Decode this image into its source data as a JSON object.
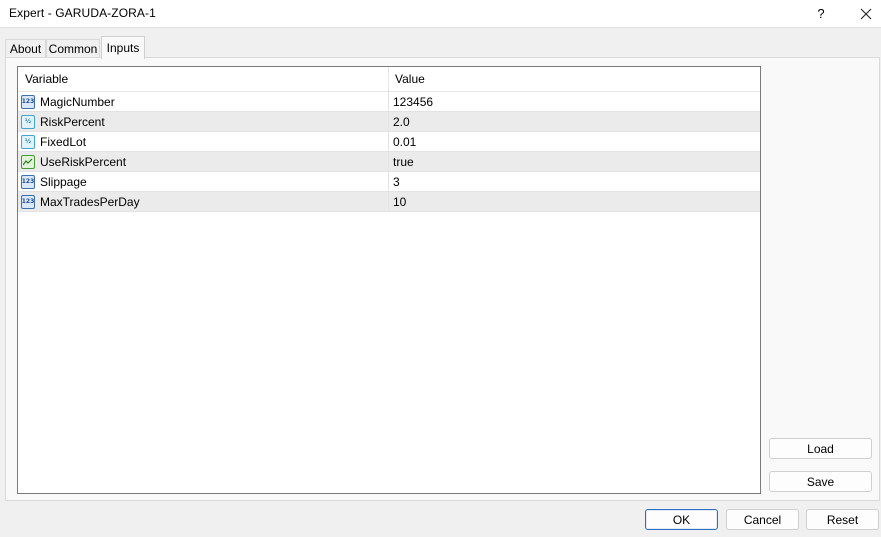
{
  "window": {
    "title": "Expert - GARUDA-ZORA-1",
    "help_label": "?"
  },
  "tabs": [
    {
      "label": "About",
      "active": false
    },
    {
      "label": "Common",
      "active": false
    },
    {
      "label": "Inputs",
      "active": true
    }
  ],
  "grid": {
    "columns": {
      "variable": "Variable",
      "value": "Value"
    },
    "rows": [
      {
        "icon": "integer-type-icon",
        "name": "MagicNumber",
        "value": "123456"
      },
      {
        "icon": "double-type-icon",
        "name": "RiskPercent",
        "value": "2.0"
      },
      {
        "icon": "double-type-icon",
        "name": "FixedLot",
        "value": "0.01"
      },
      {
        "icon": "boolean-type-icon",
        "name": "UseRiskPercent",
        "value": "true"
      },
      {
        "icon": "integer-type-icon",
        "name": "Slippage",
        "value": "3"
      },
      {
        "icon": "integer-type-icon",
        "name": "MaxTradesPerDay",
        "value": "10"
      }
    ]
  },
  "side_buttons": {
    "load": "Load",
    "save": "Save"
  },
  "footer": {
    "ok": "OK",
    "cancel": "Cancel",
    "reset": "Reset"
  },
  "colors": {
    "accent": "#2f6fbf",
    "alt_row": "#ebebeb"
  }
}
